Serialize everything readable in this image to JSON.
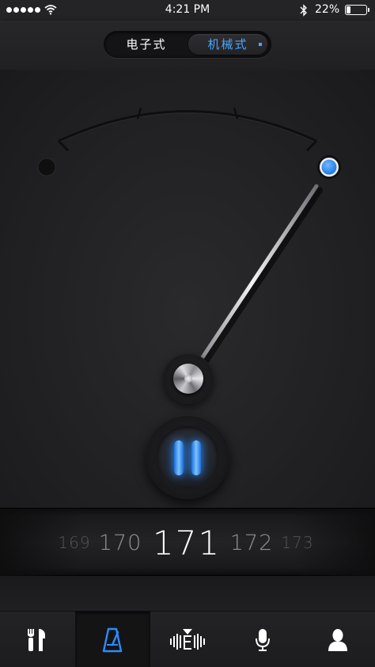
{
  "status_bar": {
    "time": "4:21 PM",
    "battery_percent": "22%",
    "battery_level": 0.22,
    "signal_dots": 5,
    "icons": [
      "signal-dots-icon",
      "wifi-icon",
      "bluetooth-icon",
      "battery-icon"
    ]
  },
  "mode_switch": {
    "options": [
      "电子式",
      "机械式"
    ],
    "selected": "机械式"
  },
  "metronome": {
    "left_marker_icon": "dot-icon",
    "right_marker_icon": "dot-icon",
    "needle_position": "right",
    "play_state_icon": "pause-icon",
    "accent_color": "#2b8cff"
  },
  "tempo": {
    "values": [
      "169",
      "170",
      "171",
      "172",
      "173"
    ],
    "current": "171"
  },
  "tab_bar": {
    "tabs": [
      {
        "icon": "tools-icon",
        "active": false
      },
      {
        "icon": "metronome-icon",
        "active": true
      },
      {
        "icon": "tuner-icon",
        "active": false
      },
      {
        "icon": "microphone-icon",
        "active": false
      },
      {
        "icon": "user-icon",
        "active": false
      }
    ],
    "active_color": "#2b8cff",
    "inactive_color": "#ffffff"
  }
}
